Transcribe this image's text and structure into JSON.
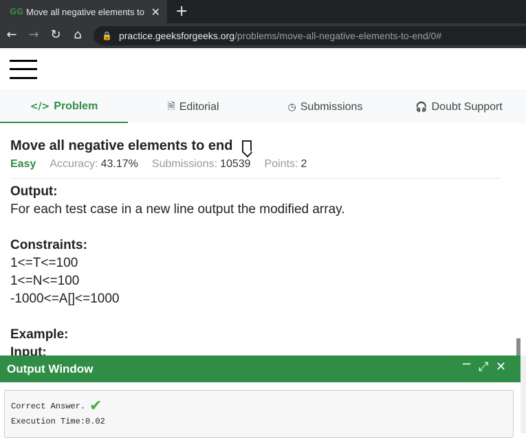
{
  "browser": {
    "tab_title": "Move all negative elements to en",
    "tab_favicon": "GG",
    "close_glyph": "✕",
    "new_tab_glyph": "+",
    "url_host": "practice.geeksforgeeks.org",
    "url_path": "/problems/move-all-negative-elements-to-end/0#"
  },
  "tabs": [
    {
      "label": "Problem",
      "icon": "code-icon",
      "glyph": "</>"
    },
    {
      "label": "Editorial",
      "icon": "document-icon",
      "glyph": "🗎"
    },
    {
      "label": "Submissions",
      "icon": "clock-icon",
      "glyph": "◷"
    },
    {
      "label": "Doubt Support",
      "icon": "headset-icon",
      "glyph": "🎧"
    }
  ],
  "problem": {
    "title": "Move all negative elements to end",
    "difficulty": "Easy",
    "accuracy_label": "Accuracy:",
    "accuracy_value": "43.17%",
    "submissions_label": "Submissions:",
    "submissions_value": "10539",
    "points_label": "Points:",
    "points_value": "2"
  },
  "body": {
    "output_heading": "Output:",
    "output_text": "For each test case in a new line output the modified array.",
    "constraints_heading": "Constraints:",
    "constraints": [
      "1<=T<=100",
      "1<=N<=100",
      "-1000<=A[]<=1000"
    ],
    "example_heading": "Example:",
    "input_heading": "Input:"
  },
  "output_window": {
    "title": "Output Window",
    "result_text": "Correct Answer.",
    "time_text": "Execution Time:0.02"
  },
  "colors": {
    "brand_green": "#2f8d46"
  }
}
